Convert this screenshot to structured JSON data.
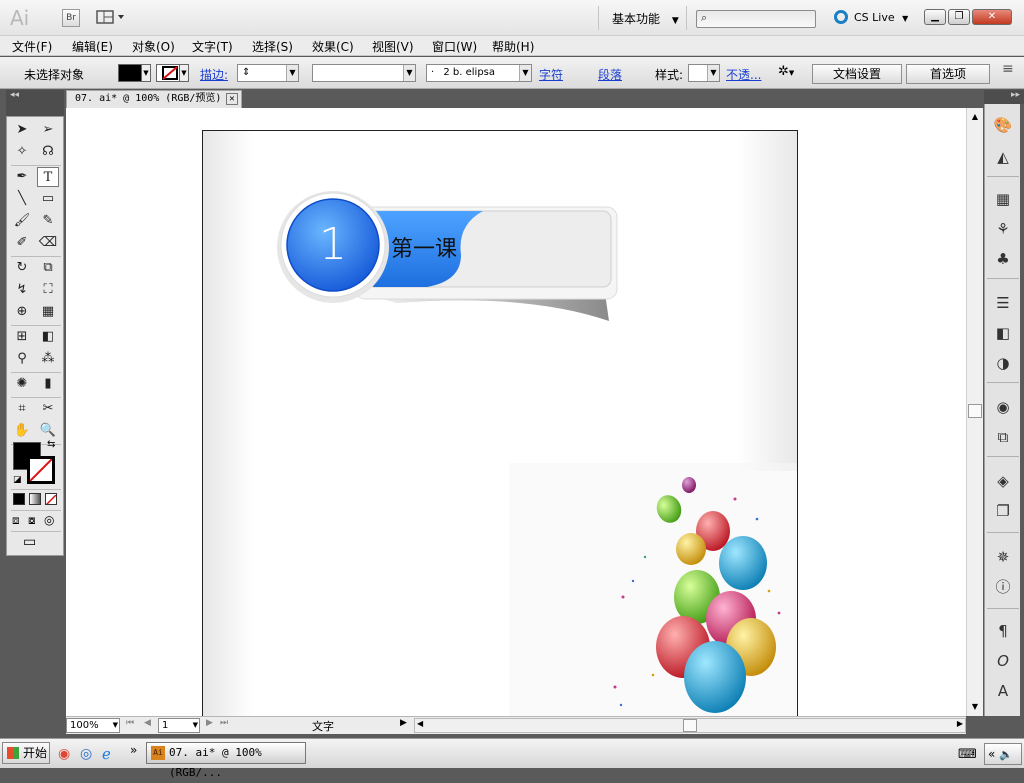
{
  "titlebar": {
    "logo": "Ai",
    "bridge_label": "Br",
    "workspace": "基本功能",
    "search_placeholder": "",
    "cslive": "CS Live"
  },
  "menu": [
    "文件(F)",
    "编辑(E)",
    "对象(O)",
    "文字(T)",
    "选择(S)",
    "效果(C)",
    "视图(V)",
    "窗口(W)",
    "帮助(H)"
  ],
  "control": {
    "selection": "未选择对象",
    "stroke_label": "描边:",
    "brush": "2 b. elipsa",
    "char_link": "字符",
    "para_link": "段落",
    "style_label": "样式:",
    "opacity_link": "不透...",
    "doc_setup": "文档设置",
    "prefs": "首选项"
  },
  "document": {
    "tab_title": "07. ai* @ 100% (RGB/预览)",
    "badge_number": "1",
    "badge_title": "第一课"
  },
  "statusbar": {
    "zoom": "100%",
    "page": "1",
    "tool": "文字"
  },
  "taskbar": {
    "start": "开始",
    "task_title": "07. ai* @ 100% (RGB/..."
  },
  "colors": {
    "badge_blue": "#2f8af0",
    "badge_blue_dark": "#1a5fd1",
    "panel_dark": "#4d4d4d"
  }
}
